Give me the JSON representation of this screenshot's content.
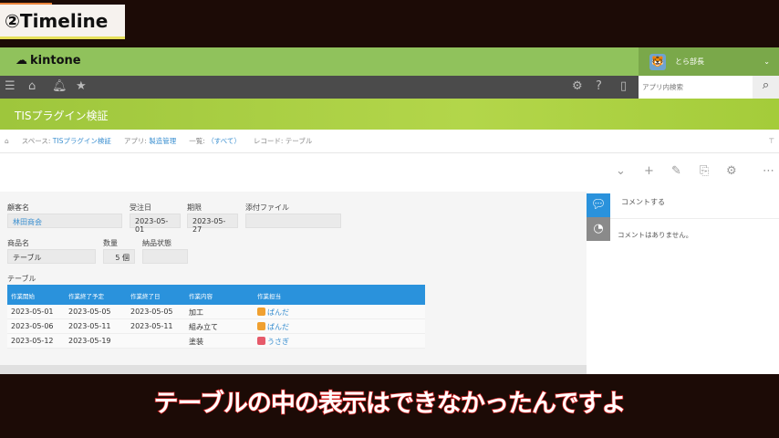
{
  "overlay_label": "②Timeline",
  "caption": "テーブルの中の表示はできなかったんですよ",
  "header": {
    "logo": "kintone",
    "user": "とら部長",
    "search_placeholder": "アプリ内検索"
  },
  "banner": {
    "title": "TISプラグイン検証"
  },
  "breadcrumb": {
    "space_prefix": "スペース: ",
    "space": "TISプラグイン検証",
    "app_prefix": "アプリ: ",
    "app": "製造管理",
    "list_prefix": "一覧: ",
    "list": "（すべて）",
    "record": "レコード: テーブル"
  },
  "form": {
    "customer_label": "顧客名",
    "customer": "林田商会",
    "order_date_label": "受注日",
    "order_date": "2023-05-01",
    "deadline_label": "期限",
    "deadline": "2023-05-27",
    "attachment_label": "添付ファイル",
    "product_label": "商品名",
    "product": "テーブル",
    "qty_label": "数量",
    "qty": "5 個",
    "status_label": "納品状態",
    "table_label": "テーブル"
  },
  "table": {
    "headers": [
      "作業開始",
      "作業終了予定",
      "作業終了日",
      "作業内容",
      "作業担当"
    ],
    "rows": [
      [
        "2023-05-01",
        "2023-05-05",
        "2023-05-05",
        "加工",
        "ぱんだ"
      ],
      [
        "2023-05-06",
        "2023-05-11",
        "2023-05-11",
        "組み立て",
        "ぱんだ"
      ],
      [
        "2023-05-12",
        "2023-05-19",
        "",
        "塗装",
        "うさぎ"
      ]
    ]
  },
  "side": {
    "comment_placeholder": "コメントする",
    "no_comments": "コメントはありません。"
  },
  "colors": {
    "header_green": "#90c25c",
    "accent_blue": "#2a92dc",
    "caption_stroke": "#d42020"
  }
}
